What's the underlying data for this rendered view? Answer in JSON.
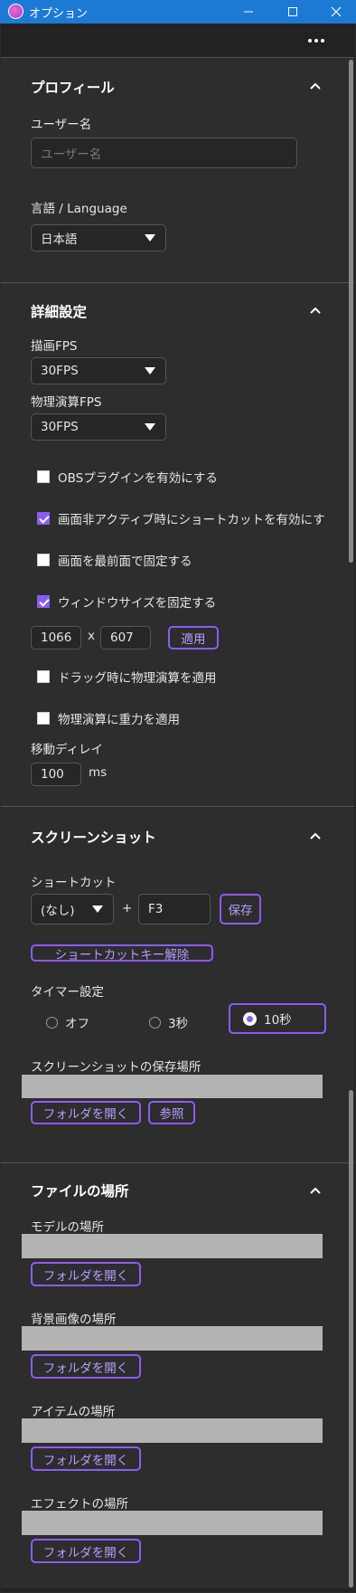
{
  "window": {
    "title": "オプション"
  },
  "profile": {
    "title": "プロフィール",
    "username_label": "ユーザー名",
    "username_placeholder": "ユーザー名",
    "language_label": "言語 / Language",
    "language_value": "日本語"
  },
  "advanced": {
    "title": "詳細設定",
    "render_fps_label": "描画FPS",
    "render_fps_value": "30FPS",
    "physics_fps_label": "物理演算FPS",
    "physics_fps_value": "30FPS",
    "checks": [
      {
        "label": "OBSプラグインを有効にする",
        "checked": false
      },
      {
        "label": "画面非アクティブ時にショートカットを有効にす",
        "checked": true
      },
      {
        "label": "画面を最前面で固定する",
        "checked": false
      },
      {
        "label": "ウィンドウサイズを固定する",
        "checked": true
      }
    ],
    "width_value": "1066",
    "times": "x",
    "height_value": "607",
    "apply_label": "適用",
    "checks2": [
      {
        "label": "ドラッグ時に物理演算を適用",
        "checked": false
      },
      {
        "label": "物理演算に重力を適用",
        "checked": false
      }
    ],
    "move_delay_label": "移動ディレイ",
    "move_delay_value": "100",
    "move_delay_unit": "ms"
  },
  "screenshot": {
    "title": "スクリーンショット",
    "shortcut_label": "ショートカット",
    "modifier_value": "(なし)",
    "plus": "+",
    "key_value": "F3",
    "save_label": "保存",
    "clear_label": "ショートカットキー解除",
    "timer_label": "タイマー設定",
    "timer_options": [
      "オフ",
      "3秒",
      "10秒"
    ],
    "timer_selected": "10秒",
    "location_label": "スクリーンショットの保存場所",
    "open_folder_label": "フォルダを開く",
    "browse_label": "参照"
  },
  "files": {
    "title": "ファイルの場所",
    "model_label": "モデルの場所",
    "background_label": "背景画像の場所",
    "item_label": "アイテムの場所",
    "effect_label": "エフェクトの場所",
    "open_folder_label": "フォルダを開く"
  },
  "colors": {
    "titlebar": "#1c7ad4",
    "accent": "#8a5cf6",
    "panel": "#2d2d2d"
  }
}
